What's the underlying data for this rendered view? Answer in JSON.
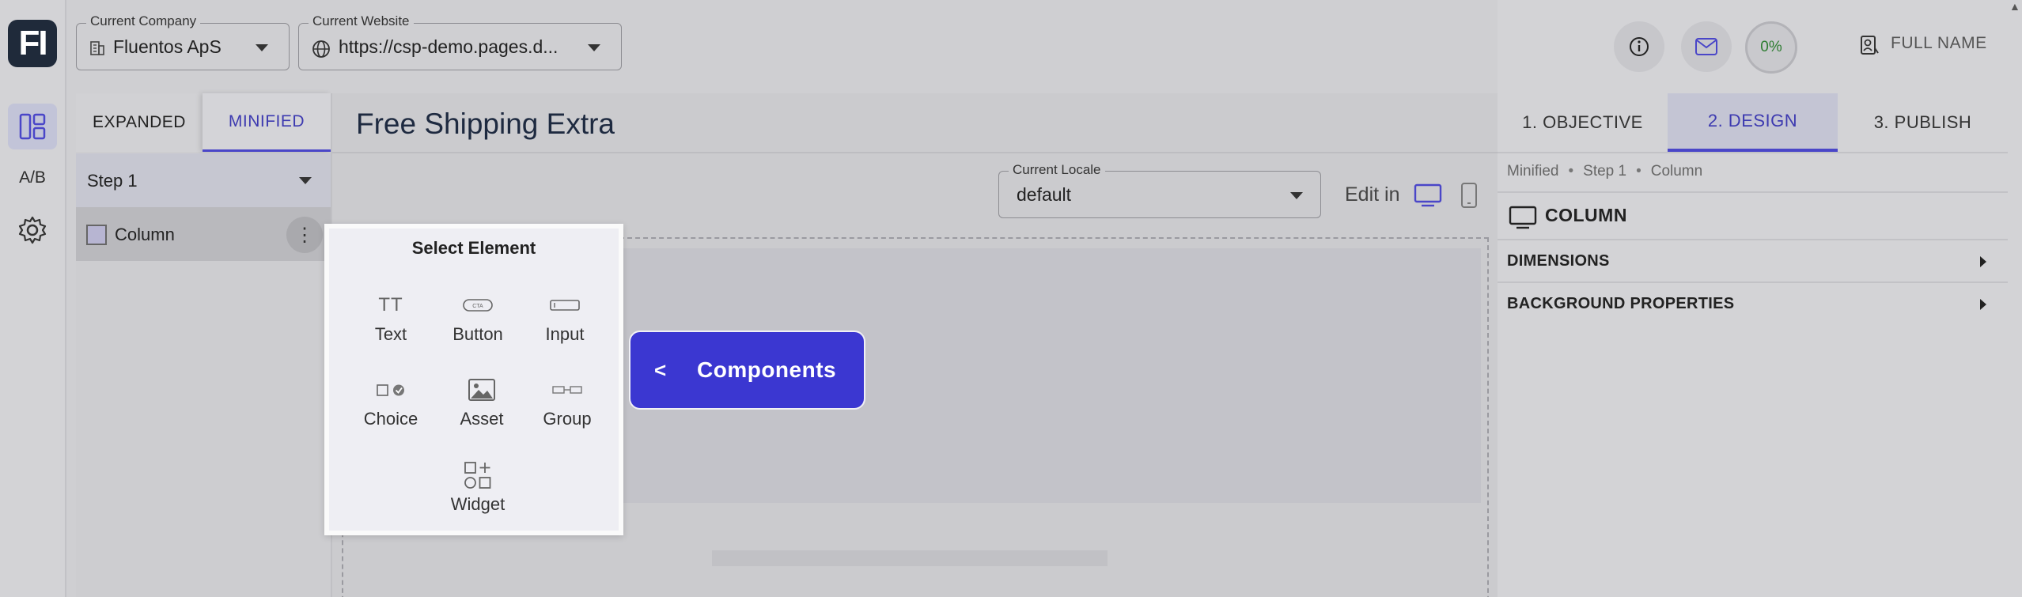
{
  "app": {
    "logo_text": "FI"
  },
  "rail": {
    "ab_label": "A/B"
  },
  "topbar": {
    "company_legend": "Current Company",
    "company_value": "Fluentos ApS",
    "website_legend": "Current Website",
    "website_value": "https://csp-demo.pages.d...",
    "progress_label": "0%",
    "user_name": "FULL NAME"
  },
  "left_panel": {
    "tabs": [
      "EXPANDED",
      "MINIFIED"
    ],
    "step_select": "Step 1",
    "tree_item": "Column"
  },
  "main": {
    "title": "Free Shipping Extra",
    "locale_legend": "Current Locale",
    "locale_value": "default",
    "edit_in_label": "Edit in"
  },
  "popup": {
    "title": "Select Element",
    "items": [
      {
        "label": "Text",
        "icon": "text-icon"
      },
      {
        "label": "Button",
        "icon": "button-icon"
      },
      {
        "label": "Input",
        "icon": "input-icon"
      },
      {
        "label": "Choice",
        "icon": "choice-icon"
      },
      {
        "label": "Asset",
        "icon": "image-icon"
      },
      {
        "label": "Group",
        "icon": "group-icon"
      },
      {
        "label": "Widget",
        "icon": "widget-icon"
      }
    ]
  },
  "components_button": {
    "arrow": "<",
    "label": "Components"
  },
  "right_panel": {
    "tabs": [
      "1. OBJECTIVE",
      "2. DESIGN",
      "3. PUBLISH"
    ],
    "active_tab": "2. DESIGN",
    "breadcrumbs": [
      "Minified",
      "Step 1",
      "Column"
    ],
    "section_title": "COLUMN",
    "accordions": [
      "DIMENSIONS",
      "BACKGROUND PROPERTIES"
    ]
  },
  "colors": {
    "accent": "#4a46c8",
    "components_button": "#3b37d1",
    "logo_bg": "#1f2a3a"
  }
}
